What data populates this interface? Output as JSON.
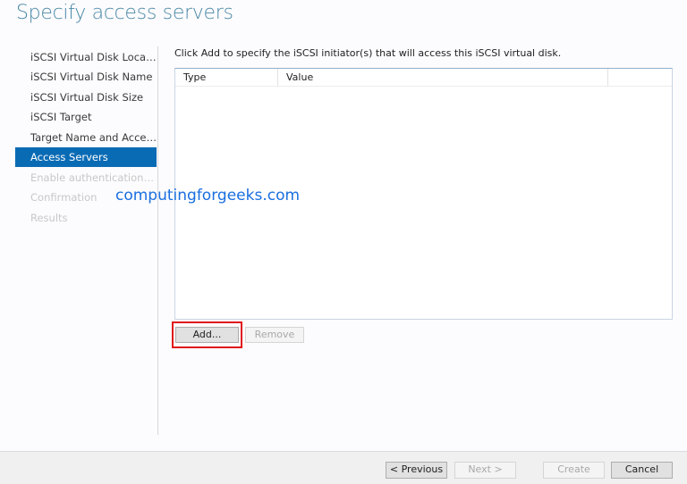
{
  "title": "Specify access servers",
  "nav": [
    "iSCSI Virtual Disk Location",
    "iSCSI Virtual Disk Name",
    "iSCSI Virtual Disk Size",
    "iSCSI Target",
    "Target Name and Access",
    "Access Servers",
    "Enable authentication ser...",
    "Confirmation",
    "Results"
  ],
  "instruction": "Click Add to specify the iSCSI initiator(s) that will access this iSCSI virtual disk.",
  "table": {
    "columns": [
      "Type",
      "Value"
    ]
  },
  "buttons": {
    "add": "Add...",
    "remove": "Remove",
    "previous": "< Previous",
    "next": "Next >",
    "create": "Create",
    "cancel": "Cancel"
  },
  "watermark": "computingforgeeks.com"
}
